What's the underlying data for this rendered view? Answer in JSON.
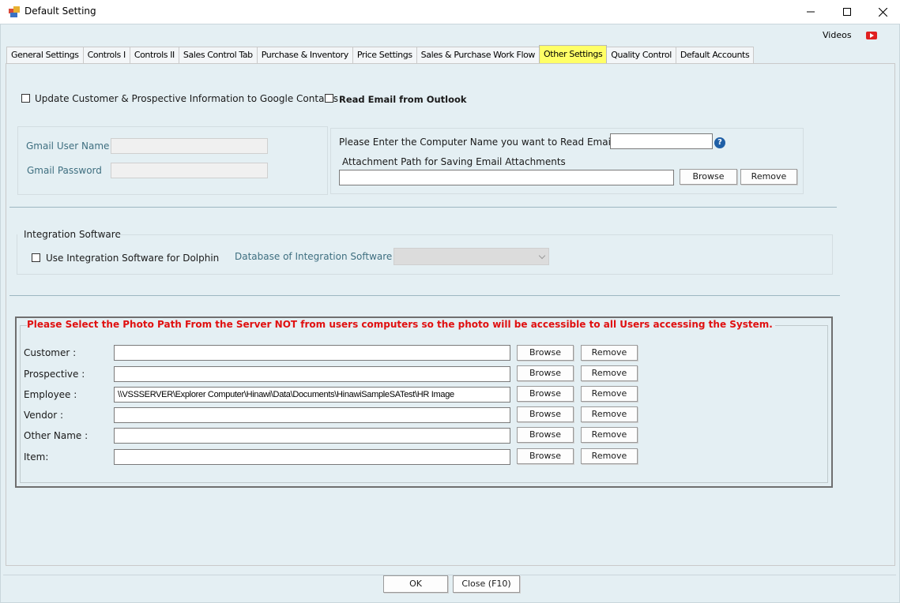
{
  "window": {
    "title": "Default Setting",
    "app_icon": "app-window-icon",
    "minimize_icon": "minimize-icon",
    "maximize_icon": "maximize-icon",
    "close_icon": "close-icon"
  },
  "header": {
    "videos_label": "Videos",
    "youtube_icon": "youtube-icon"
  },
  "tabs": [
    {
      "label": "General Settings"
    },
    {
      "label": "Controls I"
    },
    {
      "label": "Controls II"
    },
    {
      "label": "Sales Control Tab"
    },
    {
      "label": "Purchase & Inventory"
    },
    {
      "label": "Price Settings"
    },
    {
      "label": "Sales & Purchase Work Flow"
    },
    {
      "label": "Other Settings",
      "active": true
    },
    {
      "label": "Quality Control"
    },
    {
      "label": "Default Accounts"
    }
  ],
  "google": {
    "update_contacts_label": "Update Customer & Prospective Information to Google Contacts",
    "read_email_label": "Read Email from Outlook",
    "gmail_user_label": "Gmail User Name",
    "gmail_password_label": "Gmail Password",
    "gmail_user_value": "",
    "gmail_password_value": ""
  },
  "email": {
    "computer_name_label": "Please Enter the Computer Name you want to Read Email",
    "computer_name_value": "",
    "attachment_path_label": "Attachment Path for Saving Email Attachments",
    "attachment_path_value": "",
    "browse_label": "Browse",
    "remove_label": "Remove",
    "help_icon": "help-icon",
    "help_glyph": "?"
  },
  "integration": {
    "group_title": "Integration Software",
    "use_label": "Use Integration Software for Dolphin",
    "database_label": "Database of Integration Software",
    "database_value": ""
  },
  "photo_paths": {
    "warning": "Please Select the Photo Path From the Server NOT from users computers so the photo will be accessible to all Users accessing the System.",
    "browse_label": "Browse",
    "remove_label": "Remove",
    "rows": [
      {
        "label": "Customer :",
        "value": ""
      },
      {
        "label": "Prospective :",
        "value": ""
      },
      {
        "label": "Employee :",
        "value": "\\\\VSSSERVER\\Explorer Computer\\Hinawi\\Data\\Documents\\HinawiSampleSATest\\HR Image"
      },
      {
        "label": "Vendor :",
        "value": ""
      },
      {
        "label": "Other Name :",
        "value": ""
      },
      {
        "label": "Item:",
        "value": ""
      }
    ]
  },
  "footer": {
    "ok_label": "OK",
    "close_label": "Close (F10)"
  },
  "colors": {
    "background": "#e4eff3",
    "active_tab": "#ffff66",
    "warning_text": "#e01010",
    "muted_label": "#3f6f80"
  }
}
